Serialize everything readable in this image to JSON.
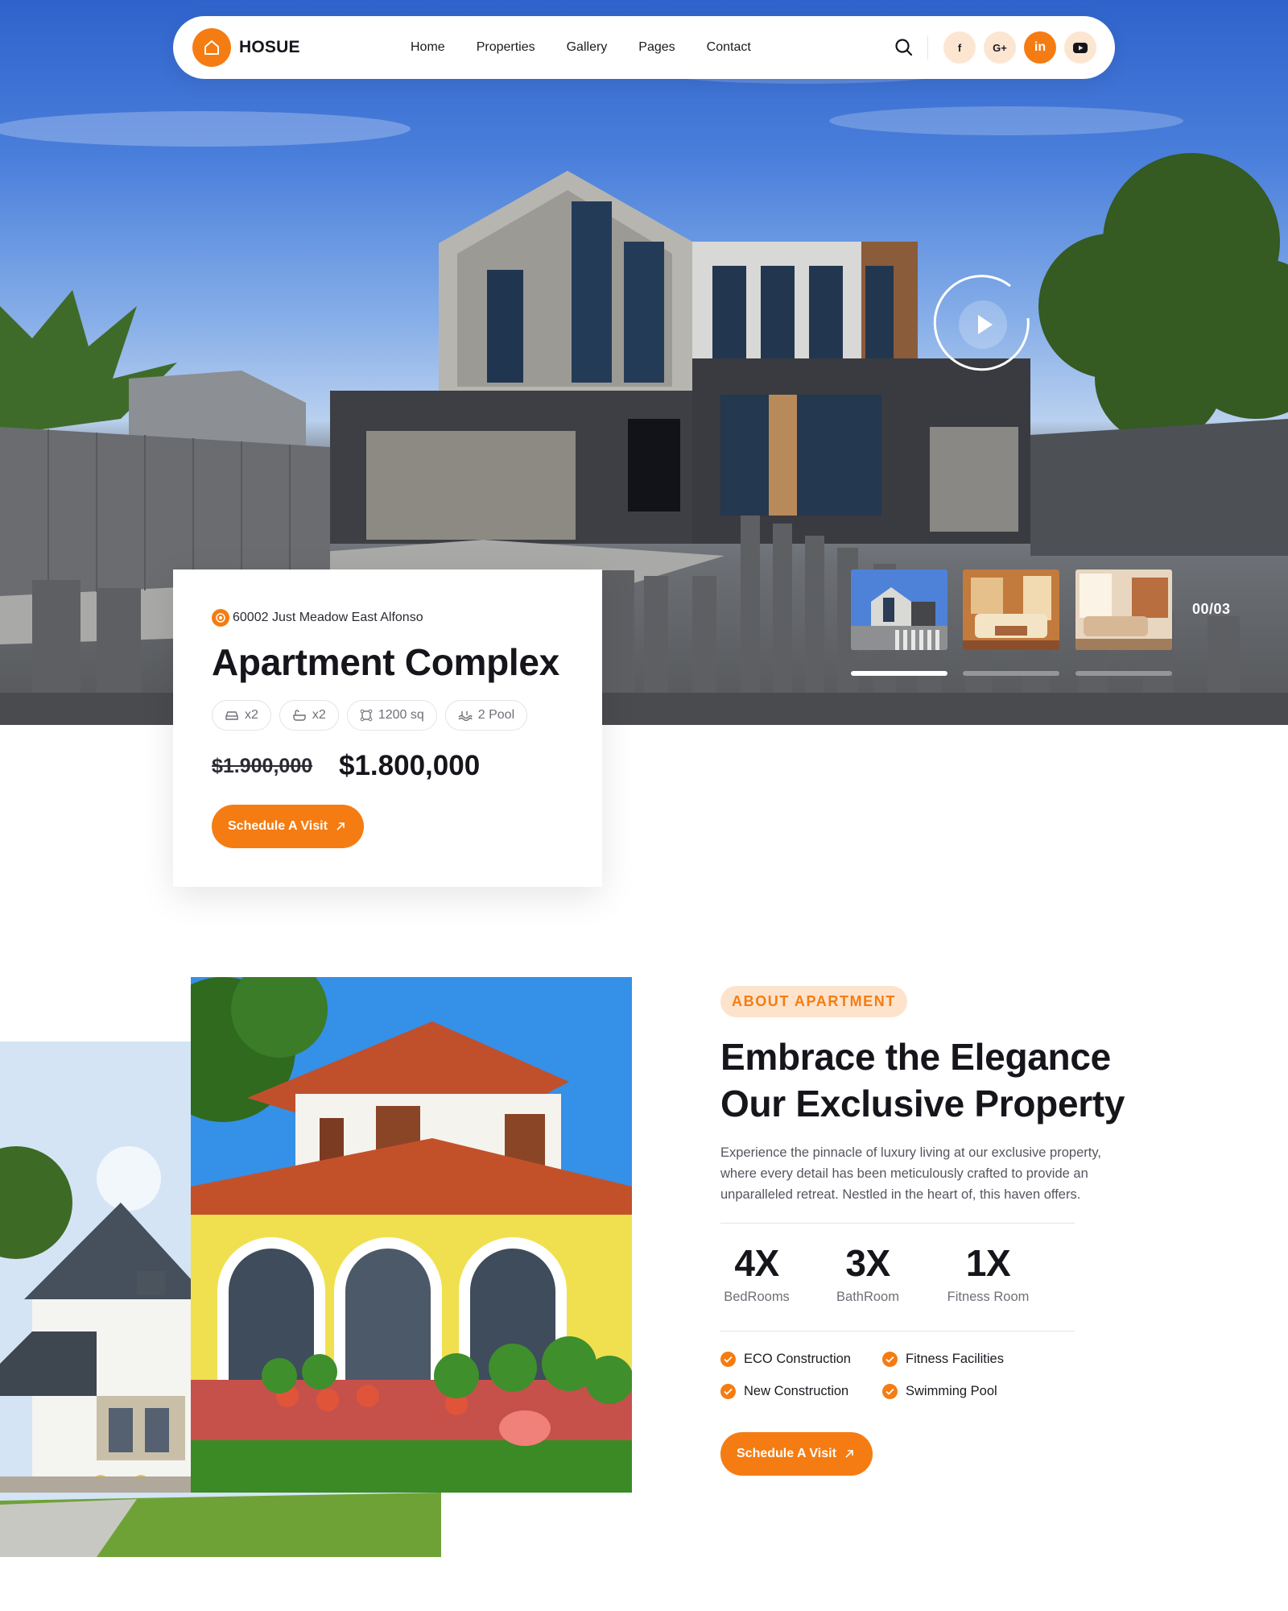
{
  "brand": {
    "name": "HOSUE",
    "accent": "#f57c12",
    "accent_light": "#fde3cc"
  },
  "nav": {
    "items": [
      "Home",
      "Properties",
      "Gallery",
      "Pages",
      "Contact"
    ],
    "social": [
      {
        "icon": "facebook-icon",
        "label": "f"
      },
      {
        "icon": "google-plus-icon",
        "label": "G+"
      },
      {
        "icon": "linkedin-icon",
        "label": "in",
        "active": true
      },
      {
        "icon": "youtube-icon",
        "label": ""
      }
    ]
  },
  "hero": {
    "slide_counter": "00/03",
    "thumbnails": [
      "house-exterior-thumb",
      "living-room-thumb",
      "lounge-thumb"
    ],
    "active_thumb": 0
  },
  "property": {
    "address": "60002 Just Meadow East Alfonso",
    "title": "Apartment Complex",
    "chips": [
      {
        "icon": "car-icon",
        "label": "x2"
      },
      {
        "icon": "bath-icon",
        "label": "x2"
      },
      {
        "icon": "area-icon",
        "label": "1200 sq"
      },
      {
        "icon": "pool-icon",
        "label": "2 Pool"
      }
    ],
    "old_price": "$1.900,000",
    "price": "$1.800,000",
    "cta": "Schedule A Visit"
  },
  "about": {
    "tag": "ABOUT APARTMENT",
    "title_line1": "Embrace the Elegance",
    "title_line2": "Our Exclusive Property",
    "description": "Experience the pinnacle of luxury living at our exclusive property, where every detail has been meticulously crafted to provide an unparalleled retreat. Nestled in the heart of, this haven offers.",
    "stats": [
      {
        "value": "4X",
        "label": "BedRooms"
      },
      {
        "value": "3X",
        "label": "BathRoom"
      },
      {
        "value": "1X",
        "label": "Fitness Room"
      }
    ],
    "features": [
      "ECO Construction",
      "Fitness Facilities",
      "New Construction",
      "Swimming Pool"
    ],
    "cta": "Schedule A Visit"
  }
}
